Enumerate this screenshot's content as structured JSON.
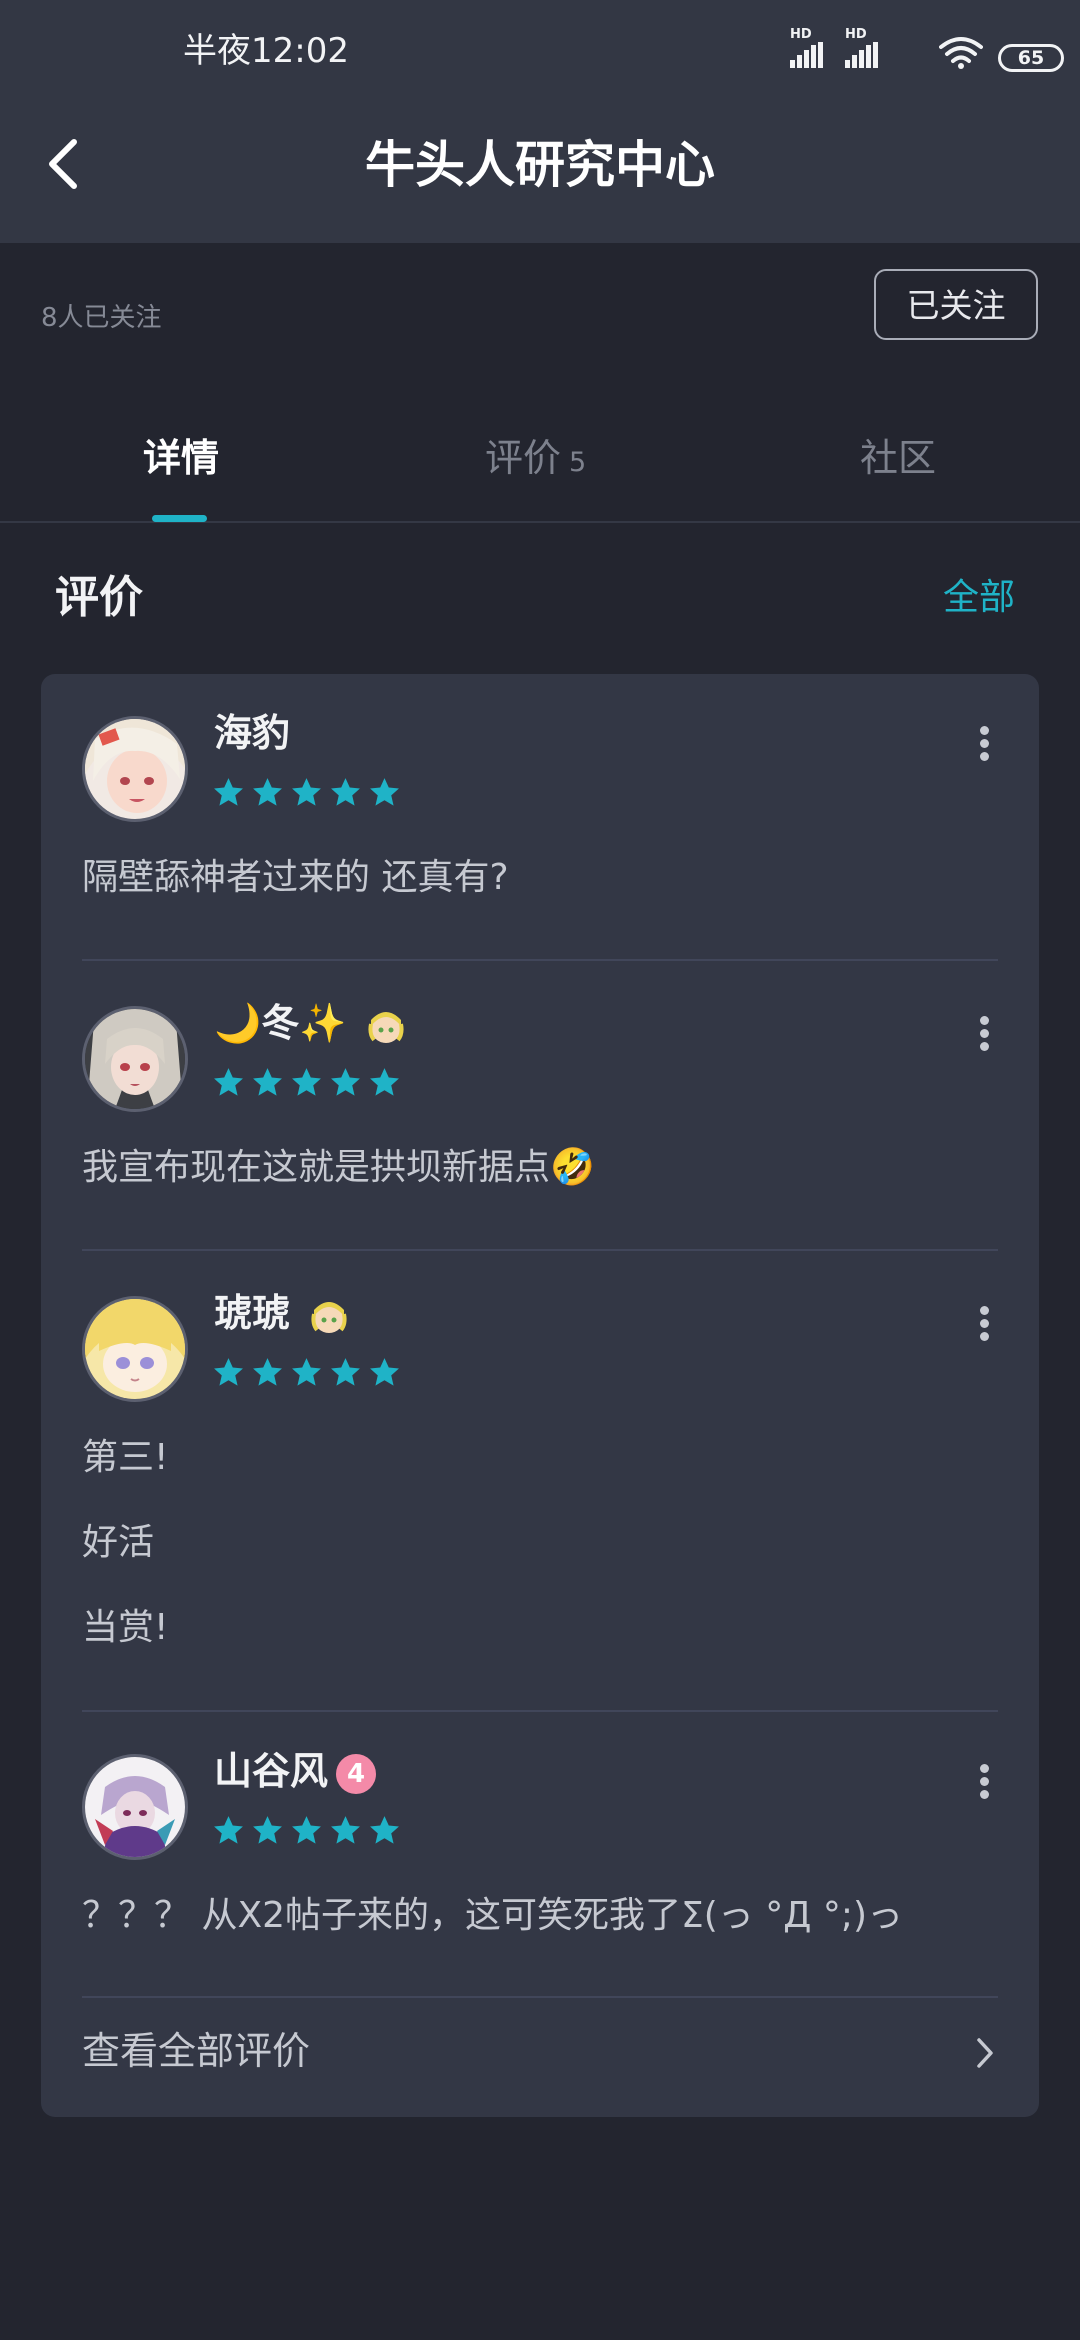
{
  "status_bar": {
    "time": "半夜12:02",
    "hd_label": "HD",
    "battery": "65"
  },
  "header": {
    "title": "牛头人研究中心"
  },
  "follow": {
    "followers": "8人已关注",
    "button_label": "已关注"
  },
  "tabs": [
    {
      "label": "详情",
      "count": ""
    },
    {
      "label": "评价",
      "count": "5"
    },
    {
      "label": "社区",
      "count": ""
    }
  ],
  "reviews_section": {
    "title": "评价",
    "all_link": "全部",
    "view_all": "查看全部评价"
  },
  "reviews": [
    {
      "username": "海豹",
      "rating": 5,
      "lines": [
        "隔壁舔神者过来的 还真有?"
      ]
    },
    {
      "username": "🌙冬✨",
      "rating": 5,
      "lines": [
        "我宣布现在这就是拱坝新据点🤣"
      ]
    },
    {
      "username": "琥琥",
      "rating": 5,
      "lines": [
        "第三!",
        "好活",
        "当赏!"
      ]
    },
    {
      "username": "山谷风",
      "badge": "4",
      "rating": 5,
      "lines": [
        "？？？ 从X2帖子来的，这可笑死我了Σ(っ °Д °;)っ"
      ]
    }
  ],
  "colors": {
    "accent": "#1fb3c7",
    "header_bg": "#333744",
    "page_bg": "#23252f",
    "card_bg": "#333745",
    "badge": "#f48aa8"
  }
}
